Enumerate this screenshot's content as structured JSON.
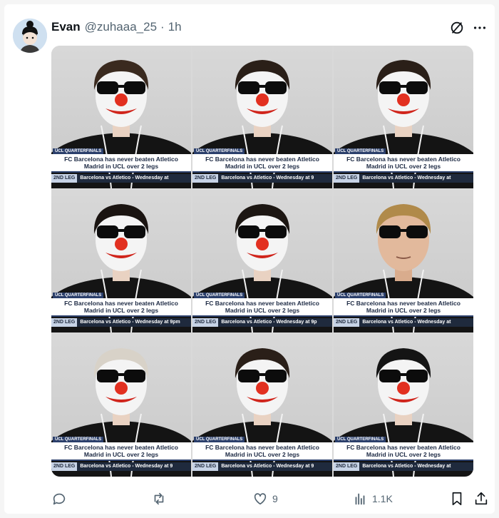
{
  "post": {
    "author_name": "Evan",
    "handle": "@zuhaaa_25",
    "separator": "·",
    "time": "1h",
    "icons": {
      "grok": "grok-icon",
      "more": "more-icon",
      "avatar": "avatar-icon"
    }
  },
  "media": {
    "tiles": [
      {
        "label": "UCL QUARTERFINALS",
        "headline": "FC Barcelona has never beaten Atletico Madrid in UCL over 2 legs",
        "leg": "2ND LEG",
        "ticker": "Barcelona vs Atletico - Wednesday at"
      },
      {
        "label": "UCL QUARTERFINALS",
        "headline": "FC Barcelona has never beaten Atletico Madrid in UCL over 2 legs",
        "leg": "2ND LEG",
        "ticker": "Barcelona vs Atletico - Wednesday at 9"
      },
      {
        "label": "UCL QUARTERFINALS",
        "headline": "FC Barcelona has never beaten Atletico Madrid in UCL over 2 legs",
        "leg": "2ND LEG",
        "ticker": "Barcelona vs Atletico - Wednesday at"
      },
      {
        "label": "UCL QUARTERFINALS",
        "headline": "FC Barcelona has never beaten Atletico Madrid in UCL over 2 legs",
        "leg": "2ND LEG",
        "ticker": "Barcelona vs Atletico - Wednesday at 9pm"
      },
      {
        "label": "UCL QUARTERFINALS",
        "headline": "FC Barcelona has never beaten Atletico Madrid in UCL over 2 legs",
        "leg": "2ND LEG",
        "ticker": "Barcelona vs Atletico - Wednesday at 9p"
      },
      {
        "label": "UCL QUARTERFINALS",
        "headline": "FC Barcelona has never beaten Atletico Madrid in UCL over 2 legs",
        "leg": "2ND LEG",
        "ticker": "Barcelona vs Atletico - Wednesday at"
      },
      {
        "label": "UCL QUARTERFINALS",
        "headline": "FC Barcelona has never beaten Atletico Madrid in UCL over 2 legs",
        "leg": "2ND LEG",
        "ticker": "Barcelona vs Atletico - Wednesday at 9"
      },
      {
        "label": "UCL QUARTERFINALS",
        "headline": "FC Barcelona has never beaten Atletico Madrid in UCL over 2 legs",
        "leg": "2ND LEG",
        "ticker": "Barcelona vs Atletico - Wednesday at 9"
      },
      {
        "label": "UCL QUARTERFINALS",
        "headline": "FC Barcelona has never beaten Atletico Madrid in UCL over 2 legs",
        "leg": "2ND LEG",
        "ticker": "Barcelona vs Atletico - Wednesday at"
      }
    ]
  },
  "actions": {
    "reply_icon": "reply-icon",
    "repost_icon": "repost-icon",
    "like_icon": "like-icon",
    "likes_count": "9",
    "views_icon": "views-icon",
    "views_count": "1.1K",
    "bookmark_icon": "bookmark-icon",
    "share_icon": "share-icon"
  },
  "colors": {
    "text": "#0f1419",
    "muted": "#536471",
    "chyron_navy": "#2b3f6b"
  }
}
